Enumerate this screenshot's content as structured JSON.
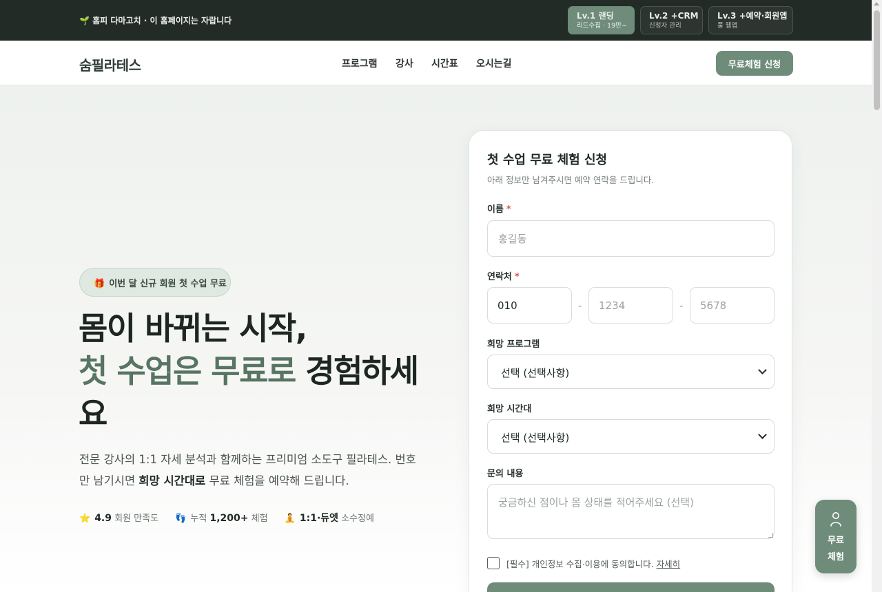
{
  "topbar": {
    "notice": "🌱 홈피 다마고치 · 이 홈페이지는 자랍니다",
    "levels": [
      {
        "title": "Lv.1 랜딩",
        "sub": "리드수집 · 19만~",
        "active": true
      },
      {
        "title": "Lv.2 +CRM",
        "sub": "신청자 관리",
        "active": false
      },
      {
        "title": "Lv.3 +예약·회원앱",
        "sub": "풀 웹앱",
        "active": false
      }
    ]
  },
  "header": {
    "logo": "숨필라테스",
    "nav": [
      "프로그램",
      "강사",
      "시간표",
      "오시는길"
    ],
    "cta": "무료체험 신청"
  },
  "hero": {
    "badge_icon": "🎁",
    "badge": "이번 달 신규 회원 첫 수업 무료",
    "title_line1": "몸이 바뀌는 시작,",
    "title_accent": "첫 수업은 무료로",
    "title_rest": " 경험하세요",
    "lead_pre": "전문 강사의 1:1 자세 분석과 함께하는 프리미엄 소도구 필라테스. 번호만 남기시면 ",
    "lead_bold": "희망 시간대로",
    "lead_post": " 무료 체험을 예약해 드립니다.",
    "stats": [
      {
        "icon": "⭐",
        "pre": "",
        "bold": "4.9",
        "post": " 회원 만족도"
      },
      {
        "icon": "👣",
        "pre": "누적 ",
        "bold": "1,200+",
        "post": " 체험"
      },
      {
        "icon": "🧘",
        "pre": "",
        "bold": "1:1·듀엣",
        "post": " 소수정예"
      }
    ]
  },
  "form": {
    "title": "첫 수업 무료 체험 신청",
    "subtitle": "아래 정보만 남겨주시면 예약 연락을 드립니다.",
    "name_label": "이름",
    "required_mark": "*",
    "name_placeholder": "홍길동",
    "phone_label": "연락처",
    "phone1_value": "010",
    "phone2_placeholder": "1234",
    "phone3_placeholder": "5678",
    "phone_sep": "-",
    "program_label": "희망 프로그램",
    "program_selected": "선택 (선택사항)",
    "time_label": "희망 시간대",
    "time_selected": "선택 (선택사항)",
    "inquiry_label": "문의 내용",
    "inquiry_placeholder": "궁금하신 점이나 몸 상태를 적어주세요 (선택)",
    "agree_text": "[필수] 개인정보 수집·이용에 동의합니다.",
    "agree_link": "자세히"
  },
  "floating": {
    "line1": "무료",
    "line2": "체험"
  },
  "colors": {
    "brand": "#6e8c79",
    "accent_text": "#587463",
    "topbar_bg": "#232b26",
    "required": "#d2584a"
  }
}
